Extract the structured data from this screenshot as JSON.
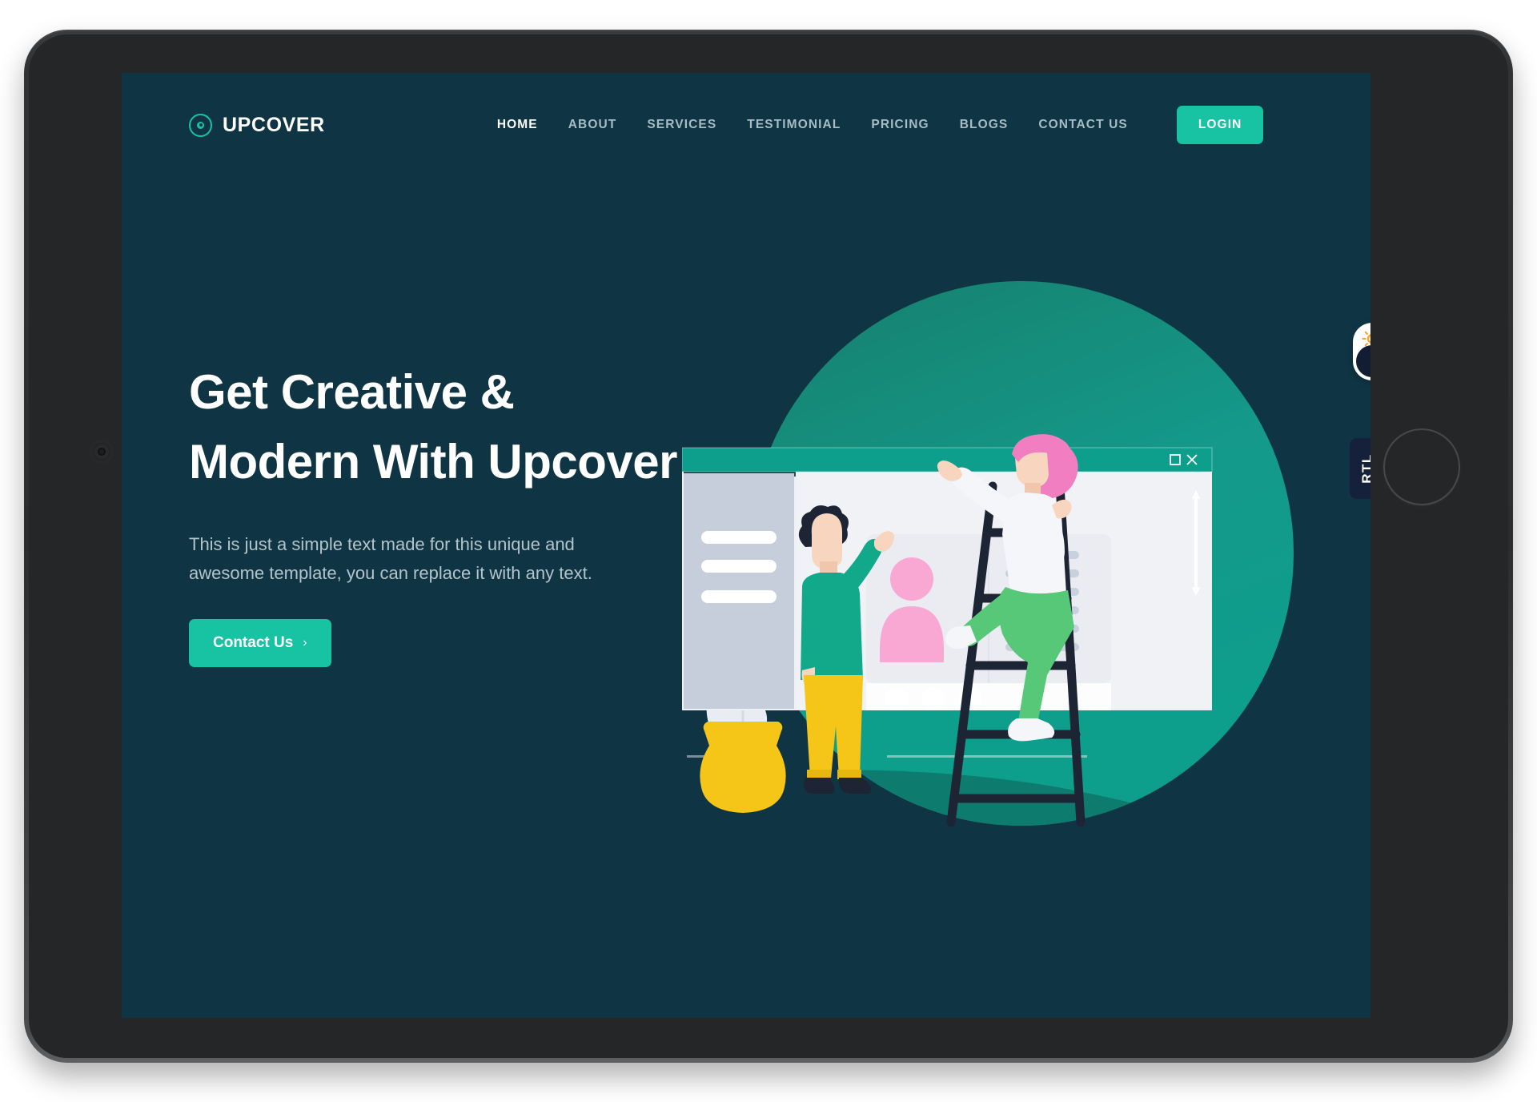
{
  "device": {
    "type": "tablet-mockup",
    "camera_icon": "camera-icon",
    "home_button_icon": "home-button-icon"
  },
  "header": {
    "brand": {
      "name": "UPCOVER",
      "icon": "gear-circle-logo-icon"
    },
    "nav": [
      {
        "label": "HOME",
        "active": true
      },
      {
        "label": "ABOUT",
        "active": false
      },
      {
        "label": "SERVICES",
        "active": false
      },
      {
        "label": "TESTIMONIAL",
        "active": false
      },
      {
        "label": "PRICING",
        "active": false
      },
      {
        "label": "BLOGS",
        "active": false
      },
      {
        "label": "CONTACT US",
        "active": false
      }
    ],
    "login_label": "LOGIN"
  },
  "hero": {
    "title": "Get Creative & Modern With Upcover",
    "subtitle": "This is just a simple text made for this unique and awesome template, you can replace it with any text.",
    "cta_label": "Contact Us",
    "cta_chevron": "chevron-right-icon"
  },
  "widgets": {
    "theme_toggle": {
      "name": "theme-toggle",
      "sun_icon": "sun-icon",
      "moon_knob_icon": "moon-knob-icon",
      "state": "dark"
    },
    "rtl_tab": {
      "label": "RTL"
    }
  },
  "illustration": {
    "name": "team-dashboard-illustration",
    "window_controls": {
      "maximize_icon": "maximize-icon",
      "close_icon": "close-icon"
    },
    "elements": [
      "green-circle-backdrop",
      "browser-window-mock",
      "sidebar-placeholder-bars",
      "profile-card-placeholder",
      "standing-person",
      "ladder",
      "climbing-person",
      "potted-plant",
      "scrollbar"
    ]
  },
  "colors": {
    "page_background": "#0f3544",
    "accent": "#17c3a2",
    "accent_dark": "#0d9488",
    "circle_backdrop": "#16806f",
    "nav_text": "#a7bcc4",
    "heading_text": "#ffffff",
    "body_text": "#b3c4cb",
    "dark_navy": "#15213a",
    "yellow": "#f5c518",
    "pink": "#f07ec0",
    "light_pink": "#f9a8d4",
    "green_pants": "#56c878",
    "device_frame": "#2b2d2f",
    "device_bezel": "#242628"
  }
}
